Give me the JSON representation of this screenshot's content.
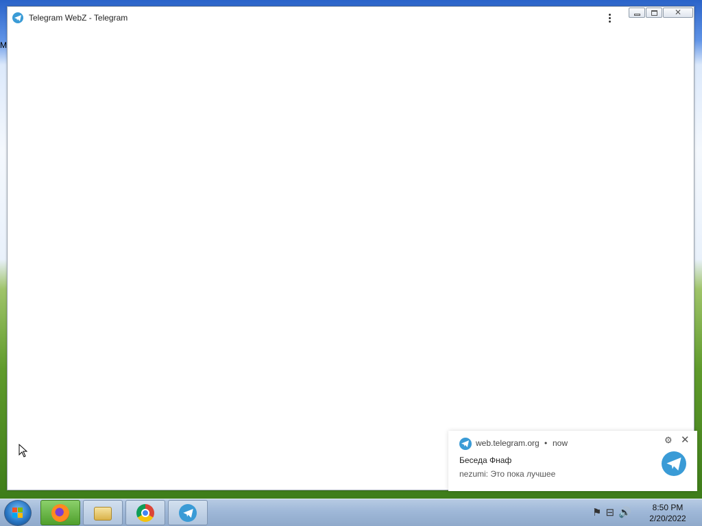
{
  "desktop": {
    "edge_label": "M"
  },
  "window": {
    "title": "Telegram WebZ - Telegram",
    "close_symbol": "✕"
  },
  "notification": {
    "site": "web.telegram.org",
    "separator": "•",
    "time": "now",
    "title": "Беседа Фнаф",
    "body": "nezumi: Это пока лучшее",
    "settings_symbol": "⚙",
    "close_symbol": "✕"
  },
  "taskbar": {
    "items": [
      "start-orb",
      "firefox",
      "file-explorer",
      "chrome",
      "telegram"
    ],
    "clock": {
      "time": "8:50 PM",
      "date": "2/20/2022"
    },
    "tray_icons": [
      "action-center-flag-icon",
      "network-icon",
      "volume-icon"
    ]
  },
  "colors": {
    "telegram_blue": "#3a9bd6",
    "taskbar": "#9fb8d8",
    "active_task": "#5fae3a"
  }
}
